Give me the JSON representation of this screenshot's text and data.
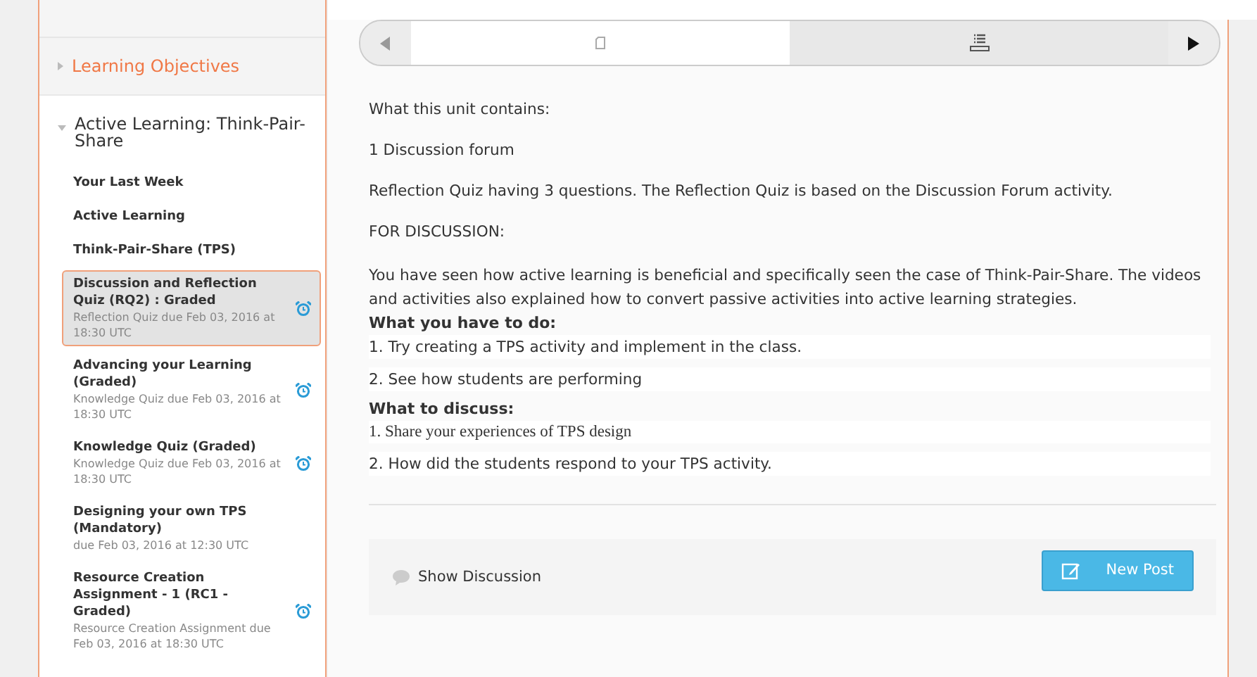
{
  "sidebar": {
    "sections": [
      {
        "label": "Learning Objectives",
        "expanded": false
      },
      {
        "label": "Active Learning: Think-Pair-Share",
        "expanded": true
      }
    ],
    "items": [
      {
        "title": "Your Last Week",
        "selected": false,
        "alarm": false
      },
      {
        "title": "Active Learning",
        "selected": false,
        "alarm": false
      },
      {
        "title": "Think-Pair-Share (TPS)",
        "selected": false,
        "alarm": false
      },
      {
        "title": "Discussion and Reflection Quiz (RQ2) : Graded",
        "subtitle": "Reflection Quiz due Feb 03, 2016 at 18:30 UTC",
        "selected": true,
        "alarm": true
      },
      {
        "title": "Advancing your Learning (Graded)",
        "subtitle": "Knowledge Quiz due Feb 03, 2016 at 18:30 UTC",
        "selected": false,
        "alarm": true
      },
      {
        "title": "Knowledge Quiz (Graded)",
        "subtitle": "Knowledge Quiz due Feb 03, 2016 at 18:30 UTC",
        "selected": false,
        "alarm": true
      },
      {
        "title": "Designing your own TPS (Mandatory)",
        "subtitle": "due Feb 03, 2016 at 12:30 UTC",
        "selected": false,
        "alarm": false
      },
      {
        "title": "Resource Creation Assignment - 1 (RC1 - Graded)",
        "subtitle": "Resource Creation Assignment due Feb 03, 2016 at 18:30 UTC",
        "selected": false,
        "alarm": true
      }
    ]
  },
  "nav_tabs": [
    {
      "kind": "page",
      "selected": true
    },
    {
      "kind": "list",
      "selected": false
    }
  ],
  "content": [
    {
      "kind": "para",
      "text": "What this unit contains:"
    },
    {
      "kind": "para",
      "text": "1 Discussion forum"
    },
    {
      "kind": "para",
      "text": "Reflection Quiz having 3 questions. The Reflection Quiz is based on the Discussion Forum activity."
    },
    {
      "kind": "para",
      "text": "FOR DISCUSSION:"
    },
    {
      "kind": "text",
      "text": "You have seen how active learning is beneficial and specifically seen the case of Think-Pair-Share. The videos and activities also explained how to convert passive activities into active learning strategies."
    },
    {
      "kind": "heading",
      "text": "What you have to do:"
    },
    {
      "kind": "list",
      "items": [
        {
          "number": "1.",
          "text": "Try creating a TPS activity and implement in the class.",
          "serif": false
        },
        {
          "number": "2.",
          "text": "See how students are performing",
          "serif": false
        }
      ]
    },
    {
      "kind": "heading",
      "text": "What to discuss:"
    },
    {
      "kind": "list",
      "items": [
        {
          "number": "1.",
          "text": "Share your experiences of TPS design",
          "serif": true
        },
        {
          "number": "2.",
          "text": "How did the students respond to your TPS activity.",
          "serif": false
        }
      ]
    }
  ],
  "footer": {
    "show_discussion": "Show Discussion",
    "new_post": "New Post"
  }
}
